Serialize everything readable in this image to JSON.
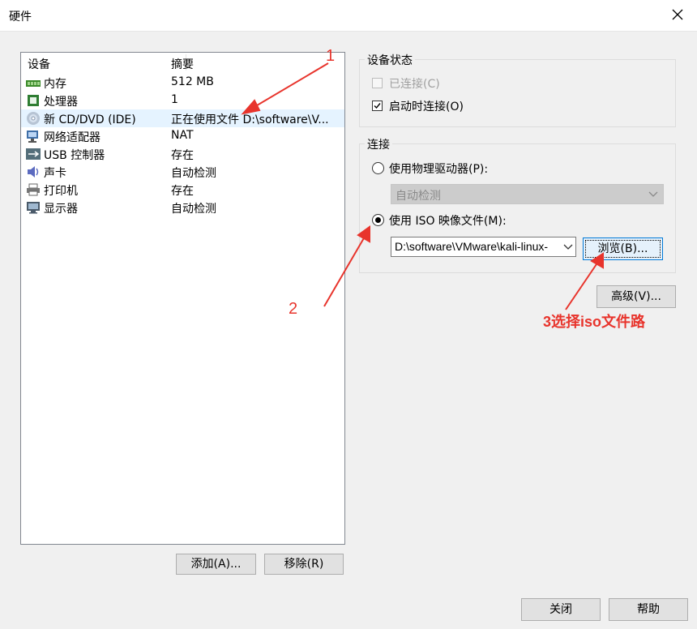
{
  "window": {
    "title": "硬件"
  },
  "device_list": {
    "columns": [
      "设备",
      "摘要"
    ],
    "items": [
      {
        "name": "内存",
        "summary": "512 MB",
        "icon": "memory-icon"
      },
      {
        "name": "处理器",
        "summary": "1",
        "icon": "cpu-icon"
      },
      {
        "name": "新 CD/DVD (IDE)",
        "summary": "正在使用文件 D:\\software\\V...",
        "icon": "cd-dvd-icon",
        "selected": true
      },
      {
        "name": "网络适配器",
        "summary": "NAT",
        "icon": "network-adapter-icon"
      },
      {
        "name": "USB 控制器",
        "summary": "存在",
        "icon": "usb-icon"
      },
      {
        "name": "声卡",
        "summary": "自动检测",
        "icon": "sound-card-icon"
      },
      {
        "name": "打印机",
        "summary": "存在",
        "icon": "printer-icon"
      },
      {
        "name": "显示器",
        "summary": "自动检测",
        "icon": "display-icon"
      }
    ],
    "add_button": "添加(A)...",
    "remove_button": "移除(R)"
  },
  "device_status": {
    "title": "设备状态",
    "connected_label": "已连接(C)",
    "connected_checked": false,
    "connected_enabled": false,
    "connect_on_power_on_label": "启动时连接(O)",
    "connect_on_power_on_checked": true
  },
  "connection": {
    "title": "连接",
    "physical_drive_label": "使用物理驱动器(P):",
    "physical_drive_selected": false,
    "physical_drive_value": "自动检测",
    "iso_label": "使用 ISO 映像文件(M):",
    "iso_selected": true,
    "iso_path": "D:\\software\\VMware\\kali-linux-",
    "browse_button": "浏览(B)..."
  },
  "advanced_button": "高级(V)...",
  "footer": {
    "close_button": "关闭",
    "help_button": "帮助"
  },
  "annotations": {
    "label_1": "1",
    "label_2": "2",
    "label_3": "3选择iso文件路",
    "color": "#e8342c"
  }
}
